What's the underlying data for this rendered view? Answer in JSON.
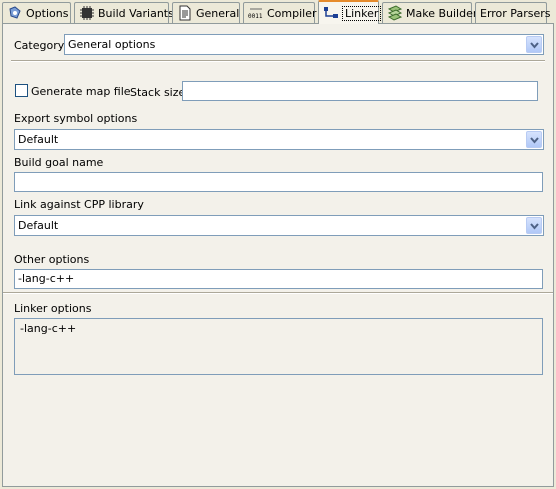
{
  "tabs": [
    {
      "label": "Options",
      "icon": "options-icon"
    },
    {
      "label": "Build Variants",
      "icon": "chip-icon"
    },
    {
      "label": "General",
      "icon": "document-icon"
    },
    {
      "label": "Compiler",
      "icon": "binary-icon"
    },
    {
      "label": "Linker",
      "icon": "linker-icon",
      "active": true
    },
    {
      "label": "Make Builder",
      "icon": "builder-icon"
    },
    {
      "label": "Error Parsers"
    }
  ],
  "category": {
    "label": "Category",
    "value": "General options"
  },
  "generate_map": {
    "label": "Generate map file",
    "checked": false
  },
  "stack_size": {
    "label": "Stack size",
    "value": ""
  },
  "export_symbol": {
    "label": "Export symbol options",
    "value": "Default"
  },
  "build_goal": {
    "label": "Build goal name",
    "value": ""
  },
  "cpp_library": {
    "label": "Link against CPP library",
    "value": "Default"
  },
  "other_options": {
    "label": "Other options",
    "value": "-lang-c++"
  },
  "linker_options": {
    "label": "Linker options",
    "value": "-lang-c++"
  },
  "colors": {
    "active_tab_accent": "#e68b2c",
    "field_border": "#7f9db9"
  }
}
